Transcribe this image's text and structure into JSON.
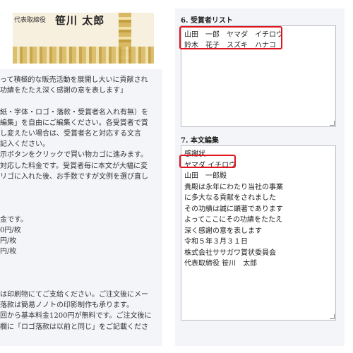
{
  "certificate": {
    "line_text": "代表取締役",
    "name": "笹川 太郎"
  },
  "left_text": [
    "って積極的な販売活動を展開し大いに貢献され",
    "功績をたたえ深く感謝の意を表します」",
    "",
    "紙・字体・ロゴ・落款・受賞者名入れ有無）を",
    "編集」を自由にご編集ください。各受賞者で賞",
    "し変えたい場合は、受賞者名と対応する文言",
    "記入ください。",
    "示ボタンをクリックで買い物カゴに進みます。",
    "対応した料金です。受賞者毎に本文が大幅に変",
    "リゴに入れた後、お手数ですが文例を選び直し",
    "",
    "",
    "",
    "金です。",
    "0円/枚",
    "円/枚",
    "円/枚",
    "",
    "",
    "",
    "は印刷物にてご支給ください。ご注文後にメー",
    "落款は簡易ノノトの印影制作も承ります。",
    "回から基本料金1200円が無料です。ご注文後に",
    "欄に「ロゴ落款は以前と同じ」をご記載くださ"
  ],
  "winners_section": {
    "label": "6. 受賞者リスト",
    "lines": [
      "山田　一郎　ヤマダ　イチロウ",
      "鈴木　花子　スズキ　ハナコ"
    ]
  },
  "body_section": {
    "label": "7. 本文編集",
    "lines": [
      "感謝状",
      "ヤマダ イチロウ",
      "山田　一郎殿",
      "貴殿は永年にわたり当社の事業",
      "に多大なる貢献をされました",
      "その功績は誠に顕著であります",
      "よってここにその功績をたたえ",
      "深く感謝の意を表します",
      "令和５年３月３１日",
      "株式会社ササガワ賞状委員会",
      "代表取締役 笹川　太郎"
    ]
  },
  "highlight_color": "#e0141e"
}
